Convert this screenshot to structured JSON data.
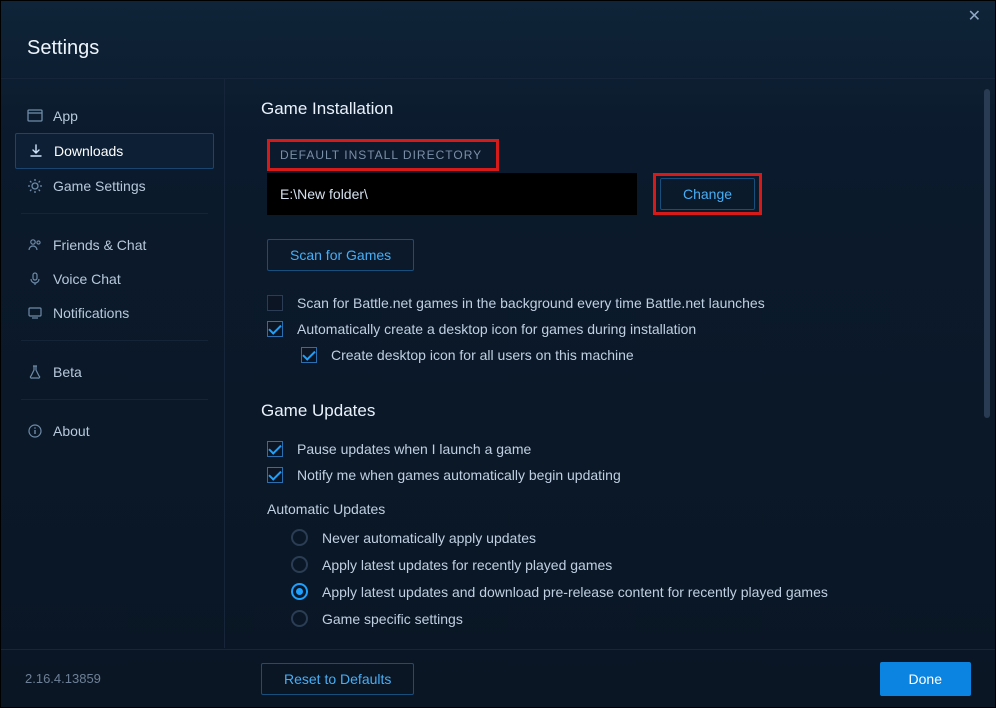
{
  "window": {
    "title": "Settings",
    "version": "2.16.4.13859"
  },
  "sidebar": {
    "items": [
      {
        "icon": "app",
        "label": "App",
        "active": false
      },
      {
        "icon": "download",
        "label": "Downloads",
        "active": true
      },
      {
        "icon": "gear",
        "label": "Game Settings",
        "active": false
      }
    ],
    "items2": [
      {
        "icon": "friends",
        "label": "Friends & Chat"
      },
      {
        "icon": "mic",
        "label": "Voice Chat"
      },
      {
        "icon": "bell",
        "label": "Notifications"
      }
    ],
    "items3": [
      {
        "icon": "flask",
        "label": "Beta"
      }
    ],
    "items4": [
      {
        "icon": "info",
        "label": "About"
      }
    ]
  },
  "main": {
    "install": {
      "title": "Game Installation",
      "default_dir_label": "DEFAULT INSTALL DIRECTORY",
      "path": "E:\\New folder\\",
      "change_label": "Change",
      "scan_label": "Scan for Games",
      "scan_bg": {
        "checked": false,
        "label": "Scan for Battle.net games in the background every time Battle.net launches"
      },
      "auto_icon": {
        "checked": true,
        "label": "Automatically create a desktop icon for games during installation"
      },
      "all_users": {
        "checked": true,
        "label": "Create desktop icon for all users on this machine"
      }
    },
    "updates": {
      "title": "Game Updates",
      "pause": {
        "checked": true,
        "label": "Pause updates when I launch a game"
      },
      "notify": {
        "checked": true,
        "label": "Notify me when games automatically begin updating"
      },
      "auto_label": "Automatic Updates",
      "options": [
        {
          "selected": false,
          "label": "Never automatically apply updates"
        },
        {
          "selected": false,
          "label": "Apply latest updates for recently played games"
        },
        {
          "selected": true,
          "label": "Apply latest updates and download pre-release content for recently played games"
        },
        {
          "selected": false,
          "label": "Game specific settings"
        }
      ]
    }
  },
  "footer": {
    "reset_label": "Reset to Defaults",
    "done_label": "Done"
  }
}
